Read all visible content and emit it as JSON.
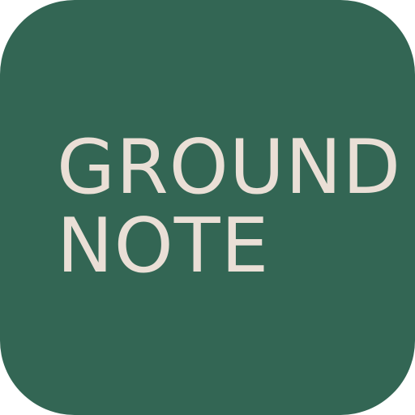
{
  "icon": {
    "wordmark": {
      "line_1": "GROUND",
      "line_2": "NOTE"
    }
  },
  "colors": {
    "background": "#336654",
    "text": "#EADFD6"
  }
}
